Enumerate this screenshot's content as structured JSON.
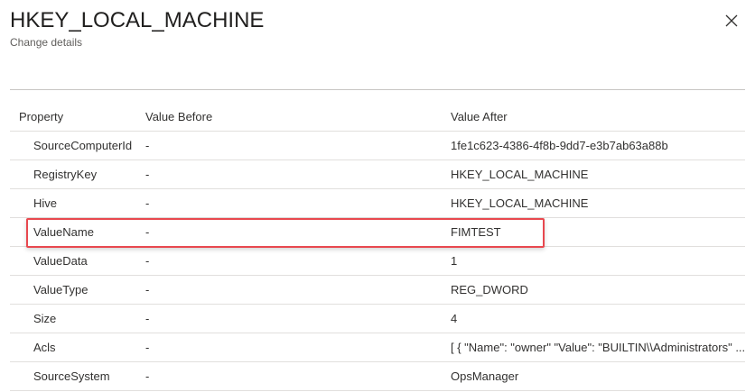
{
  "panel": {
    "title": "HKEY_LOCAL_MACHINE",
    "subtitle": "Change details"
  },
  "table": {
    "headers": [
      "Property",
      "Value Before",
      "Value After"
    ],
    "rows": [
      {
        "property": "SourceComputerId",
        "before": "-",
        "after": "1fe1c623-4386-4f8b-9dd7-e3b7ab63a88b"
      },
      {
        "property": "RegistryKey",
        "before": "-",
        "after": "HKEY_LOCAL_MACHINE"
      },
      {
        "property": "Hive",
        "before": "-",
        "after": "HKEY_LOCAL_MACHINE"
      },
      {
        "property": "ValueName",
        "before": "-",
        "after": "FIMTEST"
      },
      {
        "property": "ValueData",
        "before": "-",
        "after": "1"
      },
      {
        "property": "ValueType",
        "before": "-",
        "after": "REG_DWORD"
      },
      {
        "property": "Size",
        "before": "-",
        "after": "4"
      },
      {
        "property": "Acls",
        "before": "-",
        "after": "[ { \"Name\": \"owner\" \"Value\": \"BUILTIN\\\\Administrators\" ..."
      },
      {
        "property": "SourceSystem",
        "before": "-",
        "after": "OpsManager"
      }
    ]
  },
  "highlight_color": "#e8484f",
  "icons": {
    "close": "close-icon"
  }
}
